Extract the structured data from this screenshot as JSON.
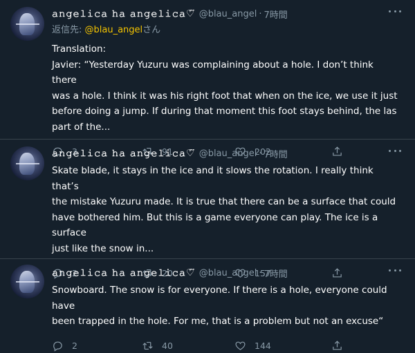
{
  "tweets": [
    {
      "display_name": "𝚊𝚗𝚐𝚎𝚕𝚒𝚌𝚊 𝚑𝚊 𝚊𝚗𝚐𝚎𝚕𝚒𝚌𝚊♡⃛",
      "handle": "@blau_angel",
      "time": "7時間",
      "reply_prefix": "返信先: ",
      "reply_mention": "@blau_angel",
      "reply_suffix": "さん",
      "text_lines": [
        "Translation:",
        "Javier: “Yesterday Yuzuru was complaining about a hole. I don’t think there",
        "was a hole. I think it was his right foot that when on the ice, we use it just",
        "before doing a jump. If during that moment this foot stays behind, the las",
        "part of the..."
      ],
      "replies": "3",
      "retweets": "91",
      "likes": "202"
    },
    {
      "display_name": "𝚊𝚗𝚐𝚎𝚕𝚒𝚌𝚊 𝚑𝚊 𝚊𝚗𝚐𝚎𝚕𝚒𝚌𝚊♡⃛",
      "handle": "@blau_angel",
      "time": "7時間",
      "text_lines": [
        "Skate blade, it stays in the ice and it slows the rotation. I really think that’s",
        "the mistake Yuzuru made. It is true that there can be a surface that could",
        "have bothered him. But this is a game everyone can play. The ice is a surface",
        "just like the snow in..."
      ],
      "replies": "2",
      "retweets": "20",
      "likes": "157"
    },
    {
      "display_name": "𝚊𝚗𝚐𝚎𝚕𝚒𝚌𝚊 𝚑𝚊 𝚊𝚗𝚐𝚎𝚕𝚒𝚌𝚊♡⃛",
      "handle": "@blau_angel",
      "time": "7時間",
      "text_lines": [
        "Snowboard. The snow is for everyone. If there is a hole, everyone could have",
        "been trapped in the hole. For me, that is a problem but not an excuse“"
      ],
      "replies": "2",
      "retweets": "40",
      "likes": "144"
    }
  ],
  "icons": {
    "reply": "reply-icon",
    "retweet": "retweet-icon",
    "like": "heart-icon",
    "share": "share-icon",
    "more": "more-icon"
  },
  "colors": {
    "background": "#15202b",
    "secondary_text": "#8899a6",
    "mention": "#f5c400",
    "divider": "#38444d"
  }
}
